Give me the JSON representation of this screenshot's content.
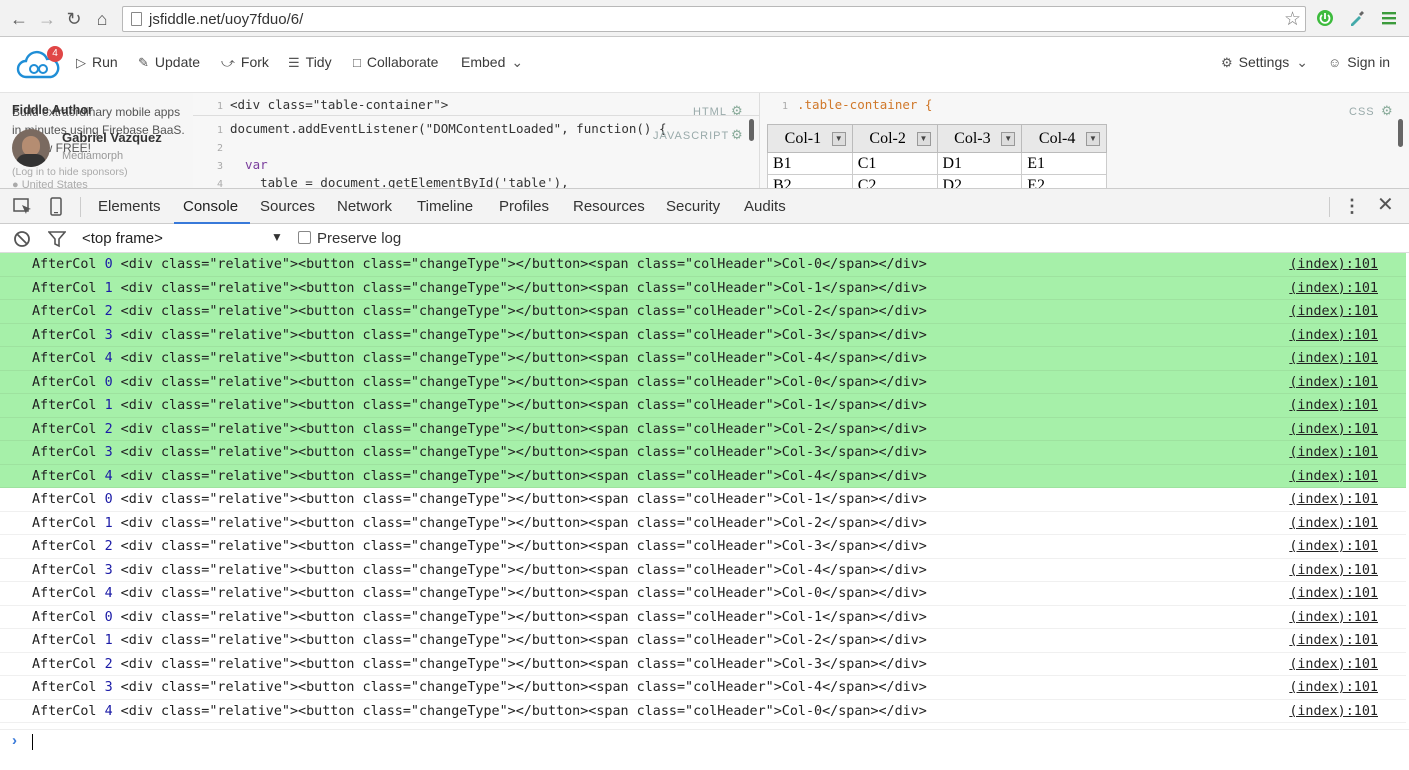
{
  "browser": {
    "url": "jsfiddle.net/uoy7fduo/6/"
  },
  "jsfiddle": {
    "notification_count": "4",
    "actions": {
      "run": "Run",
      "update": "Update",
      "fork": "Fork",
      "tidy": "Tidy",
      "collaborate": "Collaborate",
      "embed": "Embed"
    },
    "settings": "Settings",
    "sign_in": "Sign in",
    "sidebar": {
      "heading": "Fiddle Author",
      "overlap_text_1": "Build extraordinary mobile apps",
      "overlap_text_2": "in minutes using Firebase BaaS.",
      "overlap_text_3": "It's now FREE!",
      "author_name": "Gabriel Vazquez",
      "author_company": "Mediamorph",
      "hide_sponsors": "(Log in to hide sponsors)",
      "location": "United States"
    },
    "html_pane": {
      "label": "HTML",
      "line_no": "1",
      "code": "<div class=\"table-container\">"
    },
    "js_pane": {
      "label": "JAVASCRIPT",
      "lines": [
        {
          "no": "1",
          "code": "document.addEventListener(\"DOMContentLoaded\", function() {"
        },
        {
          "no": "2",
          "code": ""
        },
        {
          "no": "3",
          "code": "  var"
        },
        {
          "no": "4",
          "code": "    table = document.getElementById('table'),"
        }
      ]
    },
    "css_pane": {
      "label": "CSS",
      "line_no": "1",
      "code": ".table-container {"
    },
    "result_table": {
      "headers": [
        "Col-1",
        "Col-2",
        "Col-3",
        "Col-4"
      ],
      "rows": [
        [
          "B1",
          "C1",
          "D1",
          "E1"
        ],
        [
          "B2",
          "C2",
          "D2",
          "E2"
        ]
      ]
    }
  },
  "devtools": {
    "tabs": [
      "Elements",
      "Console",
      "Sources",
      "Network",
      "Timeline",
      "Profiles",
      "Resources",
      "Security",
      "Audits"
    ],
    "active_tab": "Console",
    "frame_selector": "<top frame>",
    "preserve_log": "Preserve log",
    "console_rows": [
      {
        "prefix": "AfterCol ",
        "num": "0",
        "html": " <div class=\"relative\"><button class=\"changeType\"></button><span class=\"colHeader\">Col-0</span></div>",
        "source": "(index):101",
        "highlighted": true
      },
      {
        "prefix": "AfterCol ",
        "num": "1",
        "html": " <div class=\"relative\"><button class=\"changeType\"></button><span class=\"colHeader\">Col-1</span></div>",
        "source": "(index):101",
        "highlighted": true
      },
      {
        "prefix": "AfterCol ",
        "num": "2",
        "html": " <div class=\"relative\"><button class=\"changeType\"></button><span class=\"colHeader\">Col-2</span></div>",
        "source": "(index):101",
        "highlighted": true
      },
      {
        "prefix": "AfterCol ",
        "num": "3",
        "html": " <div class=\"relative\"><button class=\"changeType\"></button><span class=\"colHeader\">Col-3</span></div>",
        "source": "(index):101",
        "highlighted": true
      },
      {
        "prefix": "AfterCol ",
        "num": "4",
        "html": " <div class=\"relative\"><button class=\"changeType\"></button><span class=\"colHeader\">Col-4</span></div>",
        "source": "(index):101",
        "highlighted": true
      },
      {
        "prefix": "AfterCol ",
        "num": "0",
        "html": " <div class=\"relative\"><button class=\"changeType\"></button><span class=\"colHeader\">Col-0</span></div>",
        "source": "(index):101",
        "highlighted": true
      },
      {
        "prefix": "AfterCol ",
        "num": "1",
        "html": " <div class=\"relative\"><button class=\"changeType\"></button><span class=\"colHeader\">Col-1</span></div>",
        "source": "(index):101",
        "highlighted": true
      },
      {
        "prefix": "AfterCol ",
        "num": "2",
        "html": " <div class=\"relative\"><button class=\"changeType\"></button><span class=\"colHeader\">Col-2</span></div>",
        "source": "(index):101",
        "highlighted": true
      },
      {
        "prefix": "AfterCol ",
        "num": "3",
        "html": " <div class=\"relative\"><button class=\"changeType\"></button><span class=\"colHeader\">Col-3</span></div>",
        "source": "(index):101",
        "highlighted": true
      },
      {
        "prefix": "AfterCol ",
        "num": "4",
        "html": " <div class=\"relative\"><button class=\"changeType\"></button><span class=\"colHeader\">Col-4</span></div>",
        "source": "(index):101",
        "highlighted": true
      },
      {
        "prefix": "AfterCol ",
        "num": "0",
        "html": " <div class=\"relative\"><button class=\"changeType\"></button><span class=\"colHeader\">Col-1</span></div>",
        "source": "(index):101",
        "highlighted": false
      },
      {
        "prefix": "AfterCol ",
        "num": "1",
        "html": " <div class=\"relative\"><button class=\"changeType\"></button><span class=\"colHeader\">Col-2</span></div>",
        "source": "(index):101",
        "highlighted": false
      },
      {
        "prefix": "AfterCol ",
        "num": "2",
        "html": " <div class=\"relative\"><button class=\"changeType\"></button><span class=\"colHeader\">Col-3</span></div>",
        "source": "(index):101",
        "highlighted": false
      },
      {
        "prefix": "AfterCol ",
        "num": "3",
        "html": " <div class=\"relative\"><button class=\"changeType\"></button><span class=\"colHeader\">Col-4</span></div>",
        "source": "(index):101",
        "highlighted": false
      },
      {
        "prefix": "AfterCol ",
        "num": "4",
        "html": " <div class=\"relative\"><button class=\"changeType\"></button><span class=\"colHeader\">Col-0</span></div>",
        "source": "(index):101",
        "highlighted": false
      },
      {
        "prefix": "AfterCol ",
        "num": "0",
        "html": " <div class=\"relative\"><button class=\"changeType\"></button><span class=\"colHeader\">Col-1</span></div>",
        "source": "(index):101",
        "highlighted": false
      },
      {
        "prefix": "AfterCol ",
        "num": "1",
        "html": " <div class=\"relative\"><button class=\"changeType\"></button><span class=\"colHeader\">Col-2</span></div>",
        "source": "(index):101",
        "highlighted": false
      },
      {
        "prefix": "AfterCol ",
        "num": "2",
        "html": " <div class=\"relative\"><button class=\"changeType\"></button><span class=\"colHeader\">Col-3</span></div>",
        "source": "(index):101",
        "highlighted": false
      },
      {
        "prefix": "AfterCol ",
        "num": "3",
        "html": " <div class=\"relative\"><button class=\"changeType\"></button><span class=\"colHeader\">Col-4</span></div>",
        "source": "(index):101",
        "highlighted": false
      },
      {
        "prefix": "AfterCol ",
        "num": "4",
        "html": " <div class=\"relative\"><button class=\"changeType\"></button><span class=\"colHeader\">Col-0</span></div>",
        "source": "(index):101",
        "highlighted": false
      }
    ]
  },
  "colors": {
    "highlight_row": "#a6f0a9",
    "number": "#1a1aa6",
    "active_tab_underline": "#3879d9",
    "notification_badge": "#e04646"
  }
}
